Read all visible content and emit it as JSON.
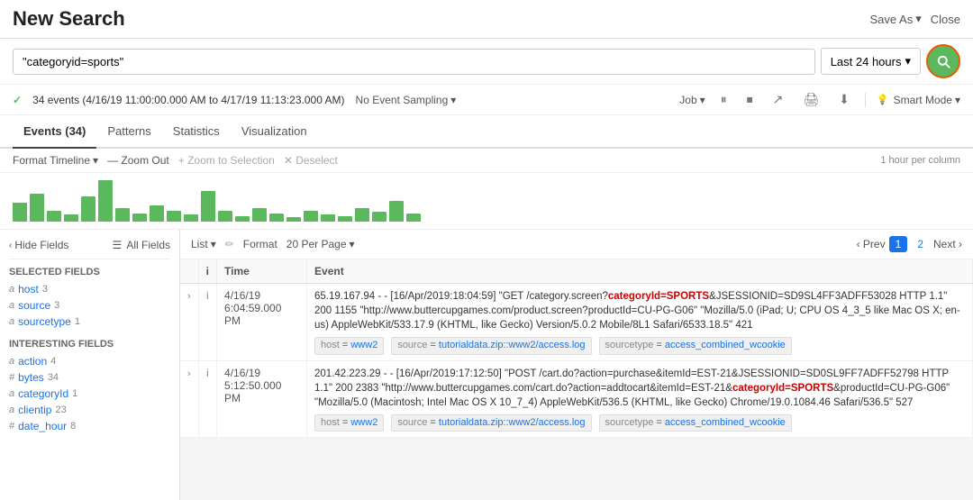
{
  "header": {
    "title": "New Search",
    "save_as_label": "Save As",
    "close_label": "Close"
  },
  "search_bar": {
    "query": "\"categoryid=sports\"",
    "time_range": "Last 24 hours",
    "search_button_label": "Search"
  },
  "results_bar": {
    "check_icon": "✓",
    "events_text": "34 events (4/16/19 11:00:00.000 AM to 4/17/19 11:13:23.000 AM)",
    "sampling_label": "No Event Sampling",
    "job_label": "Job",
    "smart_mode_label": "Smart Mode"
  },
  "tabs": [
    {
      "label": "Events (34)",
      "active": true
    },
    {
      "label": "Patterns",
      "active": false
    },
    {
      "label": "Statistics",
      "active": false
    },
    {
      "label": "Visualization",
      "active": false
    }
  ],
  "timeline": {
    "format_label": "Format Timeline",
    "zoom_out_label": "— Zoom Out",
    "zoom_sel_label": "+ Zoom to Selection",
    "deselect_label": "✕ Deselect",
    "per_column_label": "1 hour per column"
  },
  "histogram": {
    "bars": [
      14,
      20,
      8,
      5,
      18,
      30,
      10,
      6,
      12,
      8,
      5,
      22,
      8,
      4,
      10,
      6,
      3,
      8,
      5,
      4,
      10,
      7,
      15,
      6
    ]
  },
  "sidebar": {
    "hide_fields_label": "Hide Fields",
    "all_fields_label": "All Fields",
    "selected_section": "SELECTED FIELDS",
    "selected_fields": [
      {
        "type": "a",
        "name": "host",
        "count": "3"
      },
      {
        "type": "a",
        "name": "source",
        "count": "3"
      },
      {
        "type": "a",
        "name": "sourcetype",
        "count": "1"
      }
    ],
    "interesting_section": "INTERESTING FIELDS",
    "interesting_fields": [
      {
        "type": "a",
        "name": "action",
        "count": "4"
      },
      {
        "type": "#",
        "name": "bytes",
        "count": "34"
      },
      {
        "type": "a",
        "name": "categoryId",
        "count": "1"
      },
      {
        "type": "a",
        "name": "clientip",
        "count": "23"
      },
      {
        "type": "#",
        "name": "date_hour",
        "count": "8"
      }
    ]
  },
  "results_controls": {
    "list_label": "List",
    "format_label": "Format",
    "perpage_label": "20 Per Page",
    "prev_label": "‹ Prev",
    "page1": "1",
    "page2": "2",
    "next_label": "Next ›"
  },
  "table": {
    "columns": [
      "",
      "i",
      "Time",
      "Event"
    ],
    "rows": [
      {
        "expand": "›",
        "info": "i",
        "time": "4/16/19\n6:04:59.000 PM",
        "event": "65.19.167.94 - - [16/Apr/2019:18:04:59] \"GET /category.screen?categoryId=SPORTS&JSESSIONID=SD9SL4FF3ADFF53028 HTTP 1.1\" 200 1155 \"http://www.buttercupgames.com/product.screen?productId=CU-PG-G06\" \"Mozilla/5.0 (iPad; U; CPU OS 4_3_5 like Mac OS X; en-us) AppleWebKit/533.17.9 (KHTML, like Gecko) Version/5.0.2 Mobile/8L1 Safari/6533.18.5\" 421",
        "tags": [
          {
            "key": "host",
            "val": "www2"
          },
          {
            "key": "source",
            "val": "tutorialdata.zip::www2/access.log"
          },
          {
            "key": "sourcetype",
            "val": "access_combined_wcookie"
          }
        ],
        "highlight": "categoryId=SPORTS"
      },
      {
        "expand": "›",
        "info": "i",
        "time": "4/16/19\n5:12:50.000 PM",
        "event": "201.42.223.29 - - [16/Apr/2019:17:12:50] \"POST /cart.do?action=purchase&itemId=EST-21&JSESSIONID=SD0SL9FF7ADFF52798 HTTP 1.1\" 200 2383 \"http://www.buttercupgames.com/cart.do?action=addtocart&itemId=EST-21&categoryId=SPORTS&productId=CU-PG-G06\" \"Mozilla/5.0 (Macintosh; Intel Mac OS X 10_7_4) AppleWebKit/536.5 (KHTML, like Gecko) Chrome/19.0.1084.46 Safari/536.5\" 527",
        "tags": [
          {
            "key": "host",
            "val": "www2"
          },
          {
            "key": "source",
            "val": "tutorialdata.zip::www2/access.log"
          },
          {
            "key": "sourcetype",
            "val": "access_combined_wcookie"
          }
        ],
        "highlight": "categoryId=SPORTS"
      }
    ]
  }
}
